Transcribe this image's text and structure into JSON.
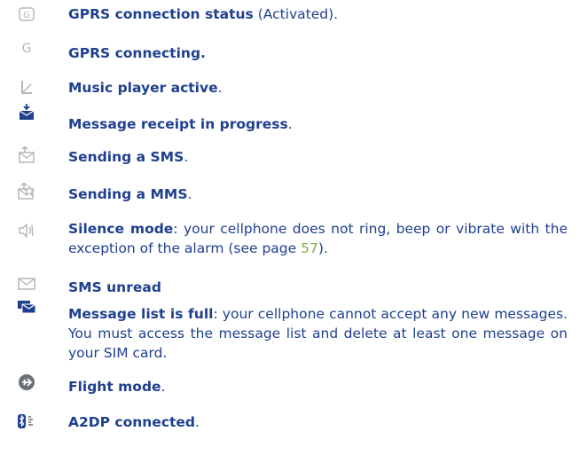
{
  "items": [
    {
      "icon": "gprs-activated-icon",
      "label": "GPRS connection status",
      "desc": " (Activated)."
    },
    {
      "icon": "gprs-connecting-icon",
      "label": "GPRS connecting.",
      "desc": ""
    },
    {
      "icon": "music-player-icon",
      "label": "Music player active",
      "desc": "."
    },
    {
      "icon": "message-receipt-icon",
      "label": "Message receipt in progress",
      "desc": "."
    },
    {
      "icon": "sending-sms-icon",
      "label": "Sending a SMS",
      "desc": "."
    },
    {
      "icon": "sending-mms-icon",
      "label": "Sending a MMS",
      "desc": "."
    },
    {
      "icon": "silence-mode-icon",
      "label": "Silence mode",
      "desc_pre": ": your cellphone does not ring, beep or vibrate with the exception of the alarm (see page ",
      "page": "57",
      "desc_post": ")."
    },
    {
      "icon": "sms-unread-icon",
      "label": "SMS unread",
      "desc": ""
    },
    {
      "icon": "message-list-full-icon",
      "label": "Message list is full",
      "desc": ": your cellphone cannot accept any new messages. You must access the message list and delete at least one message on your SIM card."
    },
    {
      "icon": "flight-mode-icon",
      "label": "Flight mode",
      "desc": "."
    },
    {
      "icon": "a2dp-connected-icon",
      "label": "A2DP connected",
      "desc": "."
    }
  ],
  "icon_colors": {
    "light_gray": "#b4b7bc",
    "blue": "#1f3f8f",
    "dark_gray": "#6b6f78"
  }
}
